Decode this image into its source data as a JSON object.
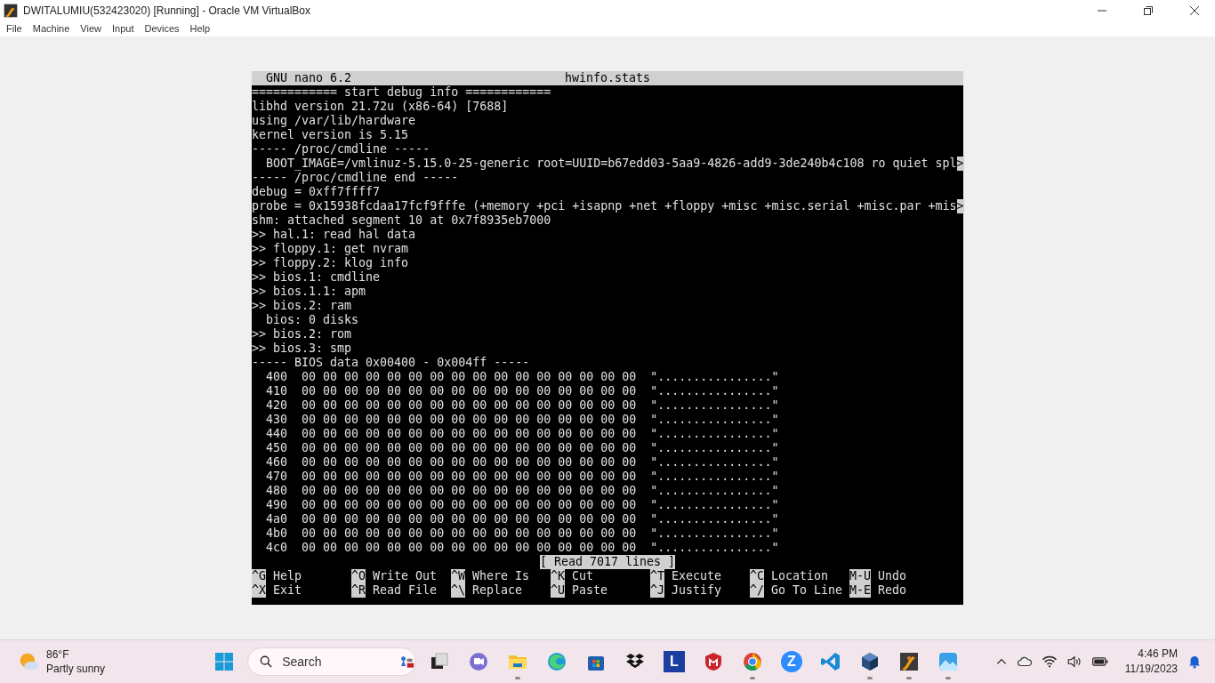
{
  "window": {
    "title": "DWITALUMIU(532423020) [Running] - Oracle VM VirtualBox"
  },
  "menu": [
    "File",
    "Machine",
    "View",
    "Input",
    "Devices",
    "Help"
  ],
  "terminal": {
    "header_left": "GNU nano 6.2",
    "header_file": "hwinfo.stats",
    "lines": [
      {
        "text": "============ start debug info ============"
      },
      {
        "text": "libhd version 21.72u (x86-64) [7688]"
      },
      {
        "text": "using /var/lib/hardware"
      },
      {
        "text": "kernel version is 5.15"
      },
      {
        "text": "----- /proc/cmdline -----"
      },
      {
        "text": "  BOOT_IMAGE=/vmlinuz-5.15.0-25-generic root=UUID=b67edd03-5aa9-4826-add9-3de240b4c108 ro quiet spl",
        "more": ">"
      },
      {
        "text": "----- /proc/cmdline end -----"
      },
      {
        "text": "debug = 0xff7ffff7"
      },
      {
        "text": "probe = 0x15938fcdaa17fcf9fffe (+memory +pci +isapnp +net +floppy +misc +misc.serial +misc.par +mis",
        "more": ">"
      },
      {
        "text": "shm: attached segment 10 at 0x7f8935eb7000"
      },
      {
        "text": ">> hal.1: read hal data"
      },
      {
        "text": ">> floppy.1: get nvram"
      },
      {
        "text": ">> floppy.2: klog info"
      },
      {
        "text": ">> bios.1: cmdline"
      },
      {
        "text": ">> bios.1.1: apm"
      },
      {
        "text": ">> bios.2: ram"
      },
      {
        "text": "  bios: 0 disks"
      },
      {
        "text": ">> bios.2: rom"
      },
      {
        "text": ">> bios.3: smp"
      },
      {
        "text": "----- BIOS data 0x00400 - 0x004ff -----"
      },
      {
        "text": "  400  00 00 00 00 00 00 00 00 00 00 00 00 00 00 00 00  \"................\""
      },
      {
        "text": "  410  00 00 00 00 00 00 00 00 00 00 00 00 00 00 00 00  \"................\""
      },
      {
        "text": "  420  00 00 00 00 00 00 00 00 00 00 00 00 00 00 00 00  \"................\""
      },
      {
        "text": "  430  00 00 00 00 00 00 00 00 00 00 00 00 00 00 00 00  \"................\""
      },
      {
        "text": "  440  00 00 00 00 00 00 00 00 00 00 00 00 00 00 00 00  \"................\""
      },
      {
        "text": "  450  00 00 00 00 00 00 00 00 00 00 00 00 00 00 00 00  \"................\""
      },
      {
        "text": "  460  00 00 00 00 00 00 00 00 00 00 00 00 00 00 00 00  \"................\""
      },
      {
        "text": "  470  00 00 00 00 00 00 00 00 00 00 00 00 00 00 00 00  \"................\""
      },
      {
        "text": "  480  00 00 00 00 00 00 00 00 00 00 00 00 00 00 00 00  \"................\""
      },
      {
        "text": "  490  00 00 00 00 00 00 00 00 00 00 00 00 00 00 00 00  \"................\""
      },
      {
        "text": "  4a0  00 00 00 00 00 00 00 00 00 00 00 00 00 00 00 00  \"................\""
      },
      {
        "text": "  4b0  00 00 00 00 00 00 00 00 00 00 00 00 00 00 00 00  \"................\""
      },
      {
        "text": "  4c0  00 00 00 00 00 00 00 00 00 00 00 00 00 00 00 00  \"................\""
      }
    ],
    "status": "[ Read 7017 lines ]",
    "shortcuts": [
      [
        {
          "key": "^G",
          "label": "Help"
        },
        {
          "key": "^O",
          "label": "Write Out"
        },
        {
          "key": "^W",
          "label": "Where Is"
        },
        {
          "key": "^K",
          "label": "Cut"
        },
        {
          "key": "^T",
          "label": "Execute"
        },
        {
          "key": "^C",
          "label": "Location"
        },
        {
          "key": "M-U",
          "label": "Undo"
        }
      ],
      [
        {
          "key": "^X",
          "label": "Exit"
        },
        {
          "key": "^R",
          "label": "Read File"
        },
        {
          "key": "^\\",
          "label": "Replace"
        },
        {
          "key": "^U",
          "label": "Paste"
        },
        {
          "key": "^J",
          "label": "Justify"
        },
        {
          "key": "^/",
          "label": "Go To Line"
        },
        {
          "key": "M-E",
          "label": "Redo"
        }
      ]
    ]
  },
  "taskbar": {
    "weather": {
      "temp": "86°F",
      "condition": "Partly sunny"
    },
    "search": {
      "placeholder": "Search"
    },
    "apps": [
      {
        "kind": "taskview",
        "running": false
      },
      {
        "kind": "chat",
        "running": false
      },
      {
        "kind": "folder",
        "running": true
      },
      {
        "kind": "swirl",
        "running": false
      },
      {
        "kind": "store",
        "running": false
      },
      {
        "kind": "boxes",
        "running": false
      },
      {
        "kind": "tile",
        "glyph": "L",
        "running": false
      },
      {
        "kind": "shield",
        "running": false
      },
      {
        "kind": "ring",
        "running": true
      },
      {
        "kind": "circle",
        "glyph": "Z",
        "running": false
      },
      {
        "kind": "code",
        "running": false
      },
      {
        "kind": "cube",
        "running": true
      },
      {
        "kind": "vmapp",
        "running": true
      },
      {
        "kind": "photos",
        "running": true
      }
    ],
    "clock": {
      "time": "4:46 PM",
      "date": "11/19/2023"
    }
  }
}
